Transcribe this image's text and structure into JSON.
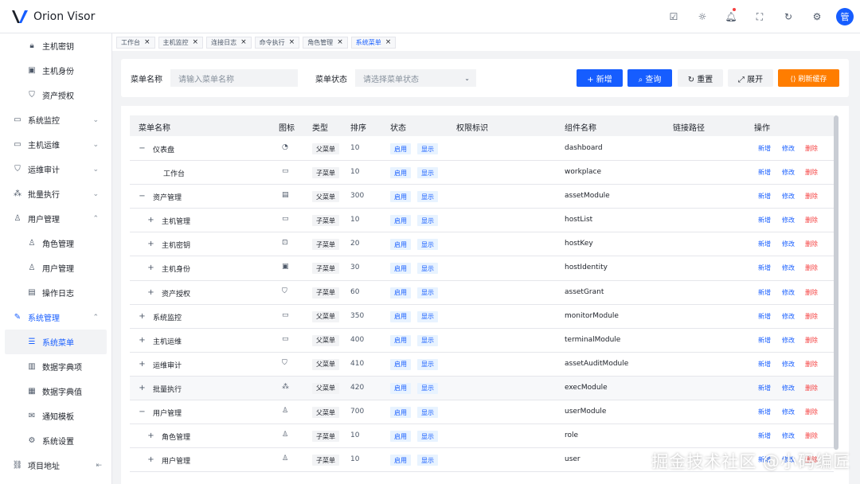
{
  "app": {
    "title": "Orion Visor",
    "avatar_text": "管"
  },
  "header": {
    "icons": [
      "doc-icon",
      "sun-icon",
      "bell-icon",
      "fullscreen-icon",
      "refresh-icon",
      "gear-icon"
    ]
  },
  "sidebar": {
    "items": [
      {
        "label": "主机密钥",
        "level": 2,
        "icon": "lock-icon",
        "glyph": "🔒︎"
      },
      {
        "label": "主机身份",
        "level": 2,
        "icon": "id-card-icon",
        "glyph": "▣"
      },
      {
        "label": "资产授权",
        "level": 2,
        "icon": "shield-icon",
        "glyph": "⛉"
      },
      {
        "label": "系统监控",
        "level": 1,
        "icon": "monitor-icon",
        "glyph": "▭",
        "chev": "⌄"
      },
      {
        "label": "主机运维",
        "level": 1,
        "icon": "desktop-icon",
        "glyph": "▭",
        "chev": "⌄"
      },
      {
        "label": "运维审计",
        "level": 1,
        "icon": "shield-icon",
        "glyph": "⛉",
        "chev": "⌄"
      },
      {
        "label": "批量执行",
        "level": 1,
        "icon": "nodes-icon",
        "glyph": "⁂",
        "chev": "⌄"
      },
      {
        "label": "用户管理",
        "level": 1,
        "icon": "user-icon",
        "glyph": "♙",
        "chev": "⌃"
      },
      {
        "label": "角色管理",
        "level": 2,
        "icon": "users-icon",
        "glyph": "♙"
      },
      {
        "label": "用户管理",
        "level": 2,
        "icon": "user-edit-icon",
        "glyph": "♙"
      },
      {
        "label": "操作日志",
        "level": 2,
        "icon": "log-icon",
        "glyph": "▤"
      },
      {
        "label": "系统管理",
        "level": 1,
        "icon": "wrench-icon",
        "glyph": "✎",
        "chev": "⌃",
        "open": true
      },
      {
        "label": "系统菜单",
        "level": 2,
        "icon": "menu-icon",
        "glyph": "☰",
        "active": true
      },
      {
        "label": "数据字典项",
        "level": 2,
        "icon": "book-icon",
        "glyph": "▥"
      },
      {
        "label": "数据字典值",
        "level": 2,
        "icon": "table-icon",
        "glyph": "▦"
      },
      {
        "label": "通知模板",
        "level": 2,
        "icon": "mail-icon",
        "glyph": "✉"
      },
      {
        "label": "系统设置",
        "level": 2,
        "icon": "gear-icon",
        "glyph": "⚙"
      },
      {
        "label": "项目地址",
        "level": 1,
        "icon": "link-icon",
        "glyph": "⛓"
      }
    ],
    "collapse_glyph": "⇤"
  },
  "tabs": [
    {
      "label": "工作台",
      "active": false
    },
    {
      "label": "主机监控",
      "active": false
    },
    {
      "label": "连接日志",
      "active": false
    },
    {
      "label": "命令执行",
      "active": false
    },
    {
      "label": "角色管理",
      "active": false
    },
    {
      "label": "系统菜单",
      "active": true
    }
  ],
  "search": {
    "name_label": "菜单名称",
    "name_placeholder": "请输入菜单名称",
    "status_label": "菜单状态",
    "status_placeholder": "请选择菜单状态",
    "add_label": "+  新增",
    "query_label": "⌕  查询",
    "reset_label": "↻  重置",
    "expand_label": "⤢  展开",
    "refresh_cache_label": "⟨⟩  刷新缓存"
  },
  "table": {
    "headers": {
      "name": "菜单名称",
      "icon": "图标",
      "type": "类型",
      "sort": "排序",
      "status": "状态",
      "perm": "权限标识",
      "component": "组件名称",
      "path": "链接路径",
      "action": "操作"
    },
    "actions": {
      "add": "新增",
      "edit": "修改",
      "delete": "删除"
    },
    "rows": [
      {
        "expand": "−",
        "indent": 0,
        "name": "仪表盘",
        "icon": "dashboard-icon",
        "glyph": "◔",
        "type": "父菜单",
        "sort": "10",
        "status": "启用",
        "visible": "显示",
        "component": "dashboard"
      },
      {
        "expand": "",
        "indent": 1,
        "name": "工作台",
        "icon": "workplace-icon",
        "glyph": "▭",
        "type": "子菜单",
        "sort": "10",
        "status": "启用",
        "visible": "显示",
        "component": "workplace"
      },
      {
        "expand": "−",
        "indent": 0,
        "name": "资产管理",
        "icon": "asset-icon",
        "glyph": "▤",
        "type": "父菜单",
        "sort": "300",
        "status": "启用",
        "visible": "显示",
        "component": "assetModule"
      },
      {
        "expand": "+",
        "indent": 1,
        "name": "主机管理",
        "icon": "desktop-icon",
        "glyph": "▭",
        "type": "子菜单",
        "sort": "10",
        "status": "启用",
        "visible": "显示",
        "component": "hostList"
      },
      {
        "expand": "+",
        "indent": 1,
        "name": "主机密钥",
        "icon": "lock-icon",
        "glyph": "⊡",
        "type": "子菜单",
        "sort": "20",
        "status": "启用",
        "visible": "显示",
        "component": "hostKey"
      },
      {
        "expand": "+",
        "indent": 1,
        "name": "主机身份",
        "icon": "id-card-icon",
        "glyph": "▣",
        "type": "子菜单",
        "sort": "30",
        "status": "启用",
        "visible": "显示",
        "component": "hostIdentity"
      },
      {
        "expand": "+",
        "indent": 1,
        "name": "资产授权",
        "icon": "shield-icon",
        "glyph": "⛉",
        "type": "子菜单",
        "sort": "60",
        "status": "启用",
        "visible": "显示",
        "component": "assetGrant"
      },
      {
        "expand": "+",
        "indent": 0,
        "name": "系统监控",
        "icon": "monitor-icon",
        "glyph": "▭",
        "type": "父菜单",
        "sort": "350",
        "status": "启用",
        "visible": "显示",
        "component": "monitorModule"
      },
      {
        "expand": "+",
        "indent": 0,
        "name": "主机运维",
        "icon": "terminal-icon",
        "glyph": "▭",
        "type": "父菜单",
        "sort": "400",
        "status": "启用",
        "visible": "显示",
        "component": "terminalModule"
      },
      {
        "expand": "+",
        "indent": 0,
        "name": "运维审计",
        "icon": "shield-icon",
        "glyph": "⛉",
        "type": "父菜单",
        "sort": "410",
        "status": "启用",
        "visible": "显示",
        "component": "assetAuditModule"
      },
      {
        "expand": "+",
        "indent": 0,
        "name": "批量执行",
        "icon": "nodes-icon",
        "glyph": "⁂",
        "type": "父菜单",
        "sort": "420",
        "status": "启用",
        "visible": "显示",
        "component": "execModule",
        "hover": true
      },
      {
        "expand": "−",
        "indent": 0,
        "name": "用户管理",
        "icon": "user-icon",
        "glyph": "♙",
        "type": "父菜单",
        "sort": "700",
        "status": "启用",
        "visible": "显示",
        "component": "userModule"
      },
      {
        "expand": "+",
        "indent": 1,
        "name": "角色管理",
        "icon": "users-icon",
        "glyph": "♙",
        "type": "子菜单",
        "sort": "10",
        "status": "启用",
        "visible": "显示",
        "component": "role"
      },
      {
        "expand": "+",
        "indent": 1,
        "name": "用户管理",
        "icon": "user-edit-icon",
        "glyph": "♙",
        "type": "子菜单",
        "sort": "10",
        "status": "启用",
        "visible": "显示",
        "component": "user"
      }
    ]
  },
  "watermark": "掘金技术社区 @小码编匠",
  "colors": {
    "primary": "#165dff",
    "warning": "#ff7d00",
    "danger": "#f53f3f",
    "tag_bg": "#e8f3ff"
  }
}
